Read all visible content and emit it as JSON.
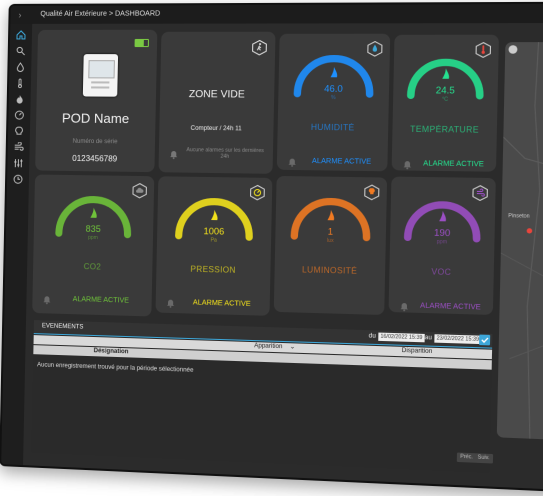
{
  "header": {
    "breadcrumb": "Qualité Air Extérieure > DASHBOARD"
  },
  "pod": {
    "name": "POD Name",
    "serial_label": "Numéro de série",
    "serial": "0123456789"
  },
  "zone": {
    "title": "ZONE VIDE",
    "counter": "Compteur / 24h 11",
    "no_alarm": "Aucune alarmes sur les dernières 24h"
  },
  "gauges": [
    {
      "key": "humidity",
      "value": "46.0",
      "unit": "%",
      "label": "HUMIDITÉ",
      "alarm": "ALARME ACTIVE",
      "color": "#1e90ff",
      "fill": 0.46,
      "icon": "droplet-icon"
    },
    {
      "key": "temperature",
      "value": "24.5",
      "unit": "°C",
      "label": "TEMPÉRATURE",
      "alarm": "ALARME ACTIVE",
      "color": "#25e08f",
      "fill": 0.55,
      "icon": "thermometer-icon"
    },
    {
      "key": "co2",
      "value": "835",
      "unit": "ppm",
      "label": "CO2",
      "alarm": "ALARME ACTIVE",
      "color": "#6fc23a",
      "fill": 0.65,
      "icon": "cloud-icon"
    },
    {
      "key": "pressure",
      "value": "1006",
      "unit": "Pa",
      "label": "PRESSION",
      "alarm": "ALARME ACTIVE",
      "color": "#f2e11c",
      "fill": 0.6,
      "icon": "gauge-icon"
    },
    {
      "key": "luminosity",
      "value": "1",
      "unit": "lux",
      "label": "LUMINOSITÉ",
      "alarm": "",
      "color": "#f07a22",
      "fill": 0.5,
      "icon": "lightbulb-icon"
    },
    {
      "key": "voc",
      "value": "190",
      "unit": "ppm",
      "label": "VOC",
      "alarm": "ALARME ACTIVE",
      "color": "#9b4fc4",
      "fill": 0.5,
      "icon": "wind-icon"
    }
  ],
  "events": {
    "title": "EVENEMENTS",
    "from_label": "du",
    "from_date": "16/02/2022 15:39",
    "to_label": "au",
    "to_date": "23/02/2022 15:39",
    "col_appearance": "Apparition",
    "col_disappearance": "Disparition",
    "col_designation": "Désignation",
    "empty": "Aucun enregistrement trouvé pour la période sélectionnée",
    "prev": "Préc.",
    "next": "Suiv."
  },
  "map": {
    "place": "Pinseton"
  },
  "colors": {
    "accent": "#3da7d9",
    "card": "#3a3a3a",
    "screen": "#2b2b2b"
  }
}
